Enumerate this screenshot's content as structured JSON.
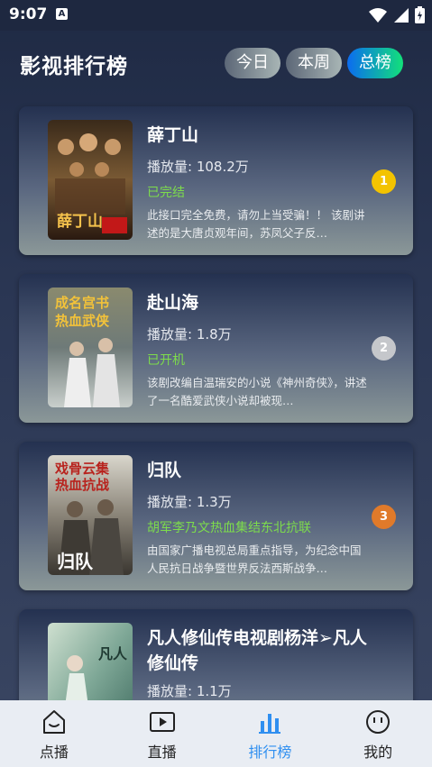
{
  "status_bar": {
    "time": "9:07",
    "notification_letter": "A"
  },
  "header": {
    "title": "影视排行榜",
    "tabs": [
      {
        "label": "今日",
        "active": false
      },
      {
        "label": "本周",
        "active": false
      },
      {
        "label": "总榜",
        "active": true
      }
    ]
  },
  "items": [
    {
      "rank": "1",
      "rank_color": "#f3c300",
      "title": "薛丁山",
      "plays": "播放量: 108.2万",
      "status": "已完结",
      "desc": "此接口完全免费，请勿上当受骗！！ 该剧讲述的是大唐贞观年间，苏凤父子反…",
      "poster_text": "薛丁山"
    },
    {
      "rank": "2",
      "rank_color": "#c5c7cb",
      "title": "赴山海",
      "plays": "播放量: 1.8万",
      "status": "已开机",
      "desc": "该剧改编自温瑞安的小说《神州奇侠》，讲述了一名酷爱武侠小说却被现…",
      "poster_text": "成名宫书 热血武侠"
    },
    {
      "rank": "3",
      "rank_color": "#e07a2a",
      "title": "归队",
      "plays": "播放量: 1.3万",
      "status": "胡军李乃文热血集结东北抗联",
      "desc": "由国家广播电视总局重点指导，为纪念中国人民抗日战争暨世界反法西斯战争…",
      "poster_text": "戏骨云集 热血抗战"
    },
    {
      "rank": "",
      "rank_color": "",
      "title": "凡人修仙传电视剧杨洋➢凡人修仙传",
      "plays": "播放量: 1.1万",
      "status": "",
      "desc": "",
      "poster_text": "凡人"
    }
  ],
  "nav": [
    {
      "label": "点播",
      "icon": "home-icon",
      "active": false
    },
    {
      "label": "直播",
      "icon": "play-icon",
      "active": false
    },
    {
      "label": "排行榜",
      "icon": "bar-chart-icon",
      "active": true
    },
    {
      "label": "我的",
      "icon": "profile-icon",
      "active": false
    }
  ]
}
